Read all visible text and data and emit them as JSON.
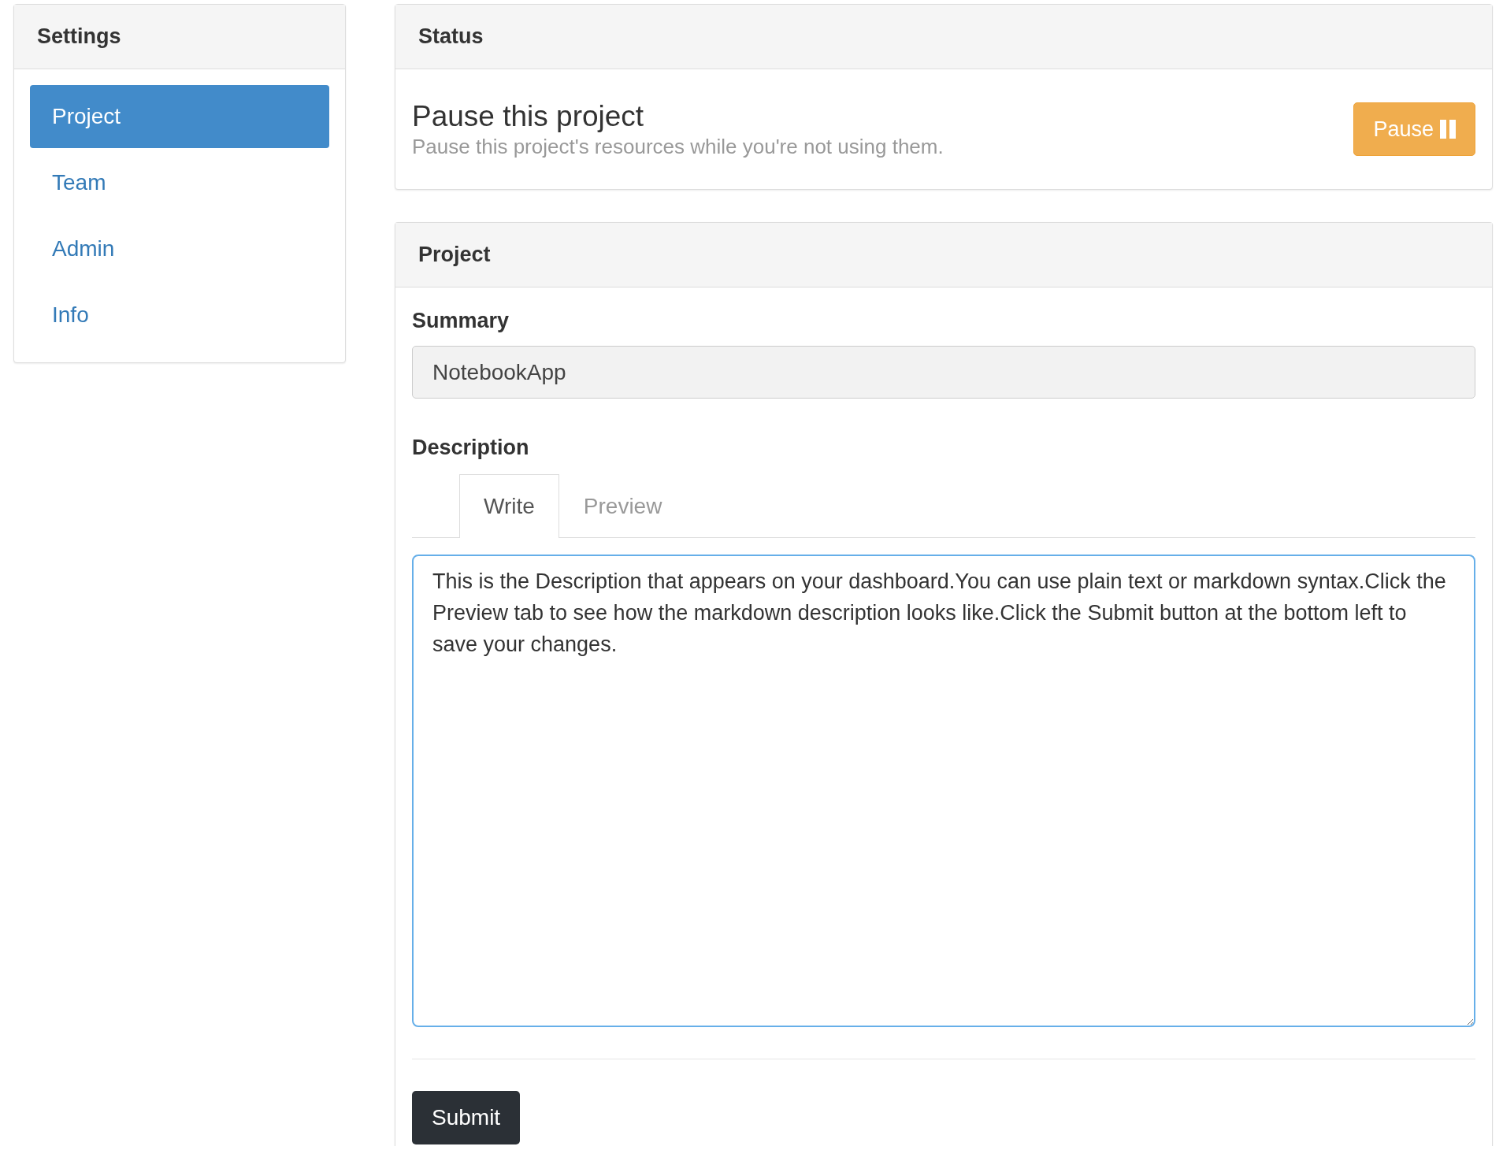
{
  "sidebar": {
    "title": "Settings",
    "items": [
      {
        "label": "Project",
        "selected": true
      },
      {
        "label": "Team",
        "selected": false
      },
      {
        "label": "Admin",
        "selected": false
      },
      {
        "label": "Info",
        "selected": false
      }
    ]
  },
  "status": {
    "title": "Status",
    "heading": "Pause this project",
    "text": "Pause this project's resources while you're not using them.",
    "button": "Pause"
  },
  "project": {
    "title": "Project",
    "summary": {
      "label": "Summary",
      "value": "NotebookApp"
    },
    "description": {
      "label": "Description",
      "tabs": [
        {
          "label": "Write",
          "selected": true
        },
        {
          "label": "Preview",
          "selected": false
        }
      ],
      "value": "This is the Description that appears on your dashboard.You can use plain text or markdown syntax.Click the Preview tab to see how the markdown description looks like.Click the Submit button at the bottom left to save your changes."
    },
    "submit": "Submit"
  }
}
